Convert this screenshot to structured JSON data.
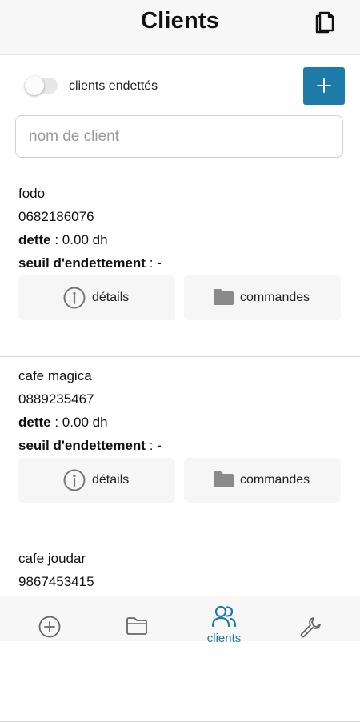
{
  "header": {
    "title": "Clients"
  },
  "filter": {
    "toggle_label": "clients endettés",
    "toggle_on": false
  },
  "search": {
    "placeholder": "nom de client",
    "value": ""
  },
  "labels": {
    "debt": "dette",
    "threshold": "seuil d'endettement",
    "details_button": "détails",
    "orders_button": "commandes"
  },
  "clients": [
    {
      "name": "fodo",
      "phone": "0682186076",
      "debt": ": 0.00 dh",
      "threshold": ": -"
    },
    {
      "name": "cafe magica",
      "phone": "0889235467",
      "debt": ": 0.00 dh",
      "threshold": ": -"
    },
    {
      "name": "cafe joudar",
      "phone": "9867453415"
    }
  ],
  "nav": {
    "active_label": "clients",
    "accent_color": "#1e7aa6"
  },
  "icons": {
    "header": "copy-icon",
    "add": "plus-icon",
    "details": "info-icon",
    "orders": "folder-icon",
    "nav": [
      "plus-circle-icon",
      "folder-icon",
      "users-icon",
      "wrench-icon"
    ]
  }
}
